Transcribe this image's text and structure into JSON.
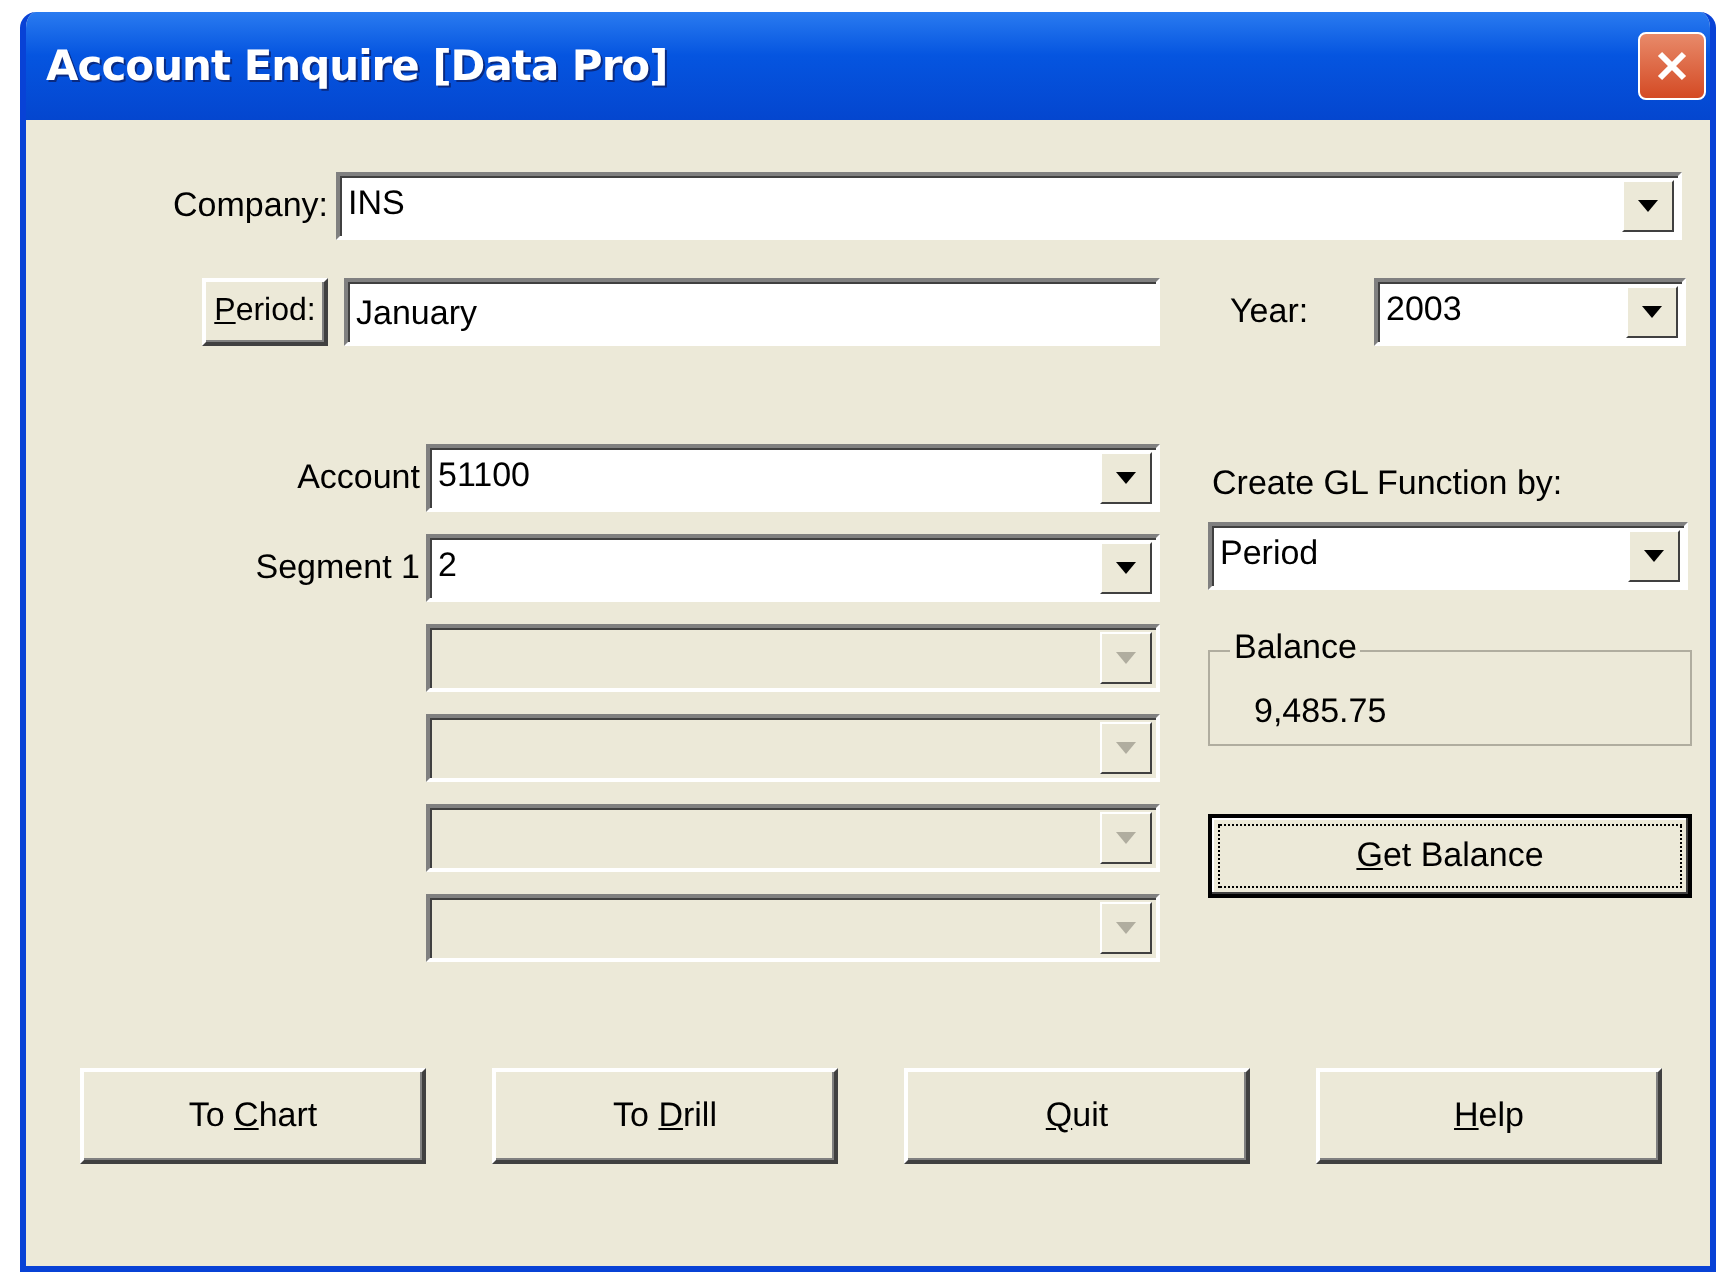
{
  "window": {
    "title": "Account Enquire [Data Pro]"
  },
  "company": {
    "label": "Company:",
    "value": "INS"
  },
  "period": {
    "button": {
      "key": "P",
      "after": "eriod:"
    },
    "value": "January"
  },
  "year": {
    "label": "Year:",
    "value": "2003"
  },
  "segments": [
    {
      "label": "Account",
      "value": "51100",
      "disabled": false
    },
    {
      "label": "Segment 1",
      "value": "2",
      "disabled": false
    },
    {
      "disabled": true
    },
    {
      "disabled": true
    },
    {
      "disabled": true
    },
    {
      "disabled": true
    }
  ],
  "function": {
    "label": "Create GL Function by:",
    "value": "Period"
  },
  "balance": {
    "legend": "Balance",
    "value": "9,485.75"
  },
  "get_balance": {
    "key": "G",
    "after": "et Balance",
    "default": true
  },
  "buttons": [
    {
      "before": "To ",
      "key": "C",
      "after": "hart"
    },
    {
      "before": "To ",
      "key": "D",
      "after": "rill"
    },
    {
      "key": "Q",
      "after": "uit"
    },
    {
      "key": "H",
      "after": "elp"
    }
  ]
}
